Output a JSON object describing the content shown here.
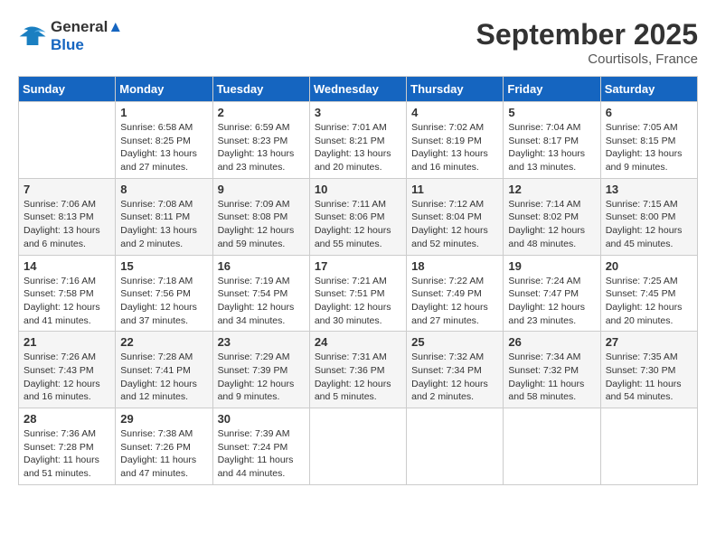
{
  "header": {
    "title": "September 2025",
    "location": "Courtisols, France",
    "logo_line1": "General",
    "logo_line2": "Blue"
  },
  "days_of_week": [
    "Sunday",
    "Monday",
    "Tuesday",
    "Wednesday",
    "Thursday",
    "Friday",
    "Saturday"
  ],
  "weeks": [
    [
      {
        "day": "",
        "sunrise": "",
        "sunset": "",
        "daylight": ""
      },
      {
        "day": "1",
        "sunrise": "Sunrise: 6:58 AM",
        "sunset": "Sunset: 8:25 PM",
        "daylight": "Daylight: 13 hours and 27 minutes."
      },
      {
        "day": "2",
        "sunrise": "Sunrise: 6:59 AM",
        "sunset": "Sunset: 8:23 PM",
        "daylight": "Daylight: 13 hours and 23 minutes."
      },
      {
        "day": "3",
        "sunrise": "Sunrise: 7:01 AM",
        "sunset": "Sunset: 8:21 PM",
        "daylight": "Daylight: 13 hours and 20 minutes."
      },
      {
        "day": "4",
        "sunrise": "Sunrise: 7:02 AM",
        "sunset": "Sunset: 8:19 PM",
        "daylight": "Daylight: 13 hours and 16 minutes."
      },
      {
        "day": "5",
        "sunrise": "Sunrise: 7:04 AM",
        "sunset": "Sunset: 8:17 PM",
        "daylight": "Daylight: 13 hours and 13 minutes."
      },
      {
        "day": "6",
        "sunrise": "Sunrise: 7:05 AM",
        "sunset": "Sunset: 8:15 PM",
        "daylight": "Daylight: 13 hours and 9 minutes."
      }
    ],
    [
      {
        "day": "7",
        "sunrise": "Sunrise: 7:06 AM",
        "sunset": "Sunset: 8:13 PM",
        "daylight": "Daylight: 13 hours and 6 minutes."
      },
      {
        "day": "8",
        "sunrise": "Sunrise: 7:08 AM",
        "sunset": "Sunset: 8:11 PM",
        "daylight": "Daylight: 13 hours and 2 minutes."
      },
      {
        "day": "9",
        "sunrise": "Sunrise: 7:09 AM",
        "sunset": "Sunset: 8:08 PM",
        "daylight": "Daylight: 12 hours and 59 minutes."
      },
      {
        "day": "10",
        "sunrise": "Sunrise: 7:11 AM",
        "sunset": "Sunset: 8:06 PM",
        "daylight": "Daylight: 12 hours and 55 minutes."
      },
      {
        "day": "11",
        "sunrise": "Sunrise: 7:12 AM",
        "sunset": "Sunset: 8:04 PM",
        "daylight": "Daylight: 12 hours and 52 minutes."
      },
      {
        "day": "12",
        "sunrise": "Sunrise: 7:14 AM",
        "sunset": "Sunset: 8:02 PM",
        "daylight": "Daylight: 12 hours and 48 minutes."
      },
      {
        "day": "13",
        "sunrise": "Sunrise: 7:15 AM",
        "sunset": "Sunset: 8:00 PM",
        "daylight": "Daylight: 12 hours and 45 minutes."
      }
    ],
    [
      {
        "day": "14",
        "sunrise": "Sunrise: 7:16 AM",
        "sunset": "Sunset: 7:58 PM",
        "daylight": "Daylight: 12 hours and 41 minutes."
      },
      {
        "day": "15",
        "sunrise": "Sunrise: 7:18 AM",
        "sunset": "Sunset: 7:56 PM",
        "daylight": "Daylight: 12 hours and 37 minutes."
      },
      {
        "day": "16",
        "sunrise": "Sunrise: 7:19 AM",
        "sunset": "Sunset: 7:54 PM",
        "daylight": "Daylight: 12 hours and 34 minutes."
      },
      {
        "day": "17",
        "sunrise": "Sunrise: 7:21 AM",
        "sunset": "Sunset: 7:51 PM",
        "daylight": "Daylight: 12 hours and 30 minutes."
      },
      {
        "day": "18",
        "sunrise": "Sunrise: 7:22 AM",
        "sunset": "Sunset: 7:49 PM",
        "daylight": "Daylight: 12 hours and 27 minutes."
      },
      {
        "day": "19",
        "sunrise": "Sunrise: 7:24 AM",
        "sunset": "Sunset: 7:47 PM",
        "daylight": "Daylight: 12 hours and 23 minutes."
      },
      {
        "day": "20",
        "sunrise": "Sunrise: 7:25 AM",
        "sunset": "Sunset: 7:45 PM",
        "daylight": "Daylight: 12 hours and 20 minutes."
      }
    ],
    [
      {
        "day": "21",
        "sunrise": "Sunrise: 7:26 AM",
        "sunset": "Sunset: 7:43 PM",
        "daylight": "Daylight: 12 hours and 16 minutes."
      },
      {
        "day": "22",
        "sunrise": "Sunrise: 7:28 AM",
        "sunset": "Sunset: 7:41 PM",
        "daylight": "Daylight: 12 hours and 12 minutes."
      },
      {
        "day": "23",
        "sunrise": "Sunrise: 7:29 AM",
        "sunset": "Sunset: 7:39 PM",
        "daylight": "Daylight: 12 hours and 9 minutes."
      },
      {
        "day": "24",
        "sunrise": "Sunrise: 7:31 AM",
        "sunset": "Sunset: 7:36 PM",
        "daylight": "Daylight: 12 hours and 5 minutes."
      },
      {
        "day": "25",
        "sunrise": "Sunrise: 7:32 AM",
        "sunset": "Sunset: 7:34 PM",
        "daylight": "Daylight: 12 hours and 2 minutes."
      },
      {
        "day": "26",
        "sunrise": "Sunrise: 7:34 AM",
        "sunset": "Sunset: 7:32 PM",
        "daylight": "Daylight: 11 hours and 58 minutes."
      },
      {
        "day": "27",
        "sunrise": "Sunrise: 7:35 AM",
        "sunset": "Sunset: 7:30 PM",
        "daylight": "Daylight: 11 hours and 54 minutes."
      }
    ],
    [
      {
        "day": "28",
        "sunrise": "Sunrise: 7:36 AM",
        "sunset": "Sunset: 7:28 PM",
        "daylight": "Daylight: 11 hours and 51 minutes."
      },
      {
        "day": "29",
        "sunrise": "Sunrise: 7:38 AM",
        "sunset": "Sunset: 7:26 PM",
        "daylight": "Daylight: 11 hours and 47 minutes."
      },
      {
        "day": "30",
        "sunrise": "Sunrise: 7:39 AM",
        "sunset": "Sunset: 7:24 PM",
        "daylight": "Daylight: 11 hours and 44 minutes."
      },
      {
        "day": "",
        "sunrise": "",
        "sunset": "",
        "daylight": ""
      },
      {
        "day": "",
        "sunrise": "",
        "sunset": "",
        "daylight": ""
      },
      {
        "day": "",
        "sunrise": "",
        "sunset": "",
        "daylight": ""
      },
      {
        "day": "",
        "sunrise": "",
        "sunset": "",
        "daylight": ""
      }
    ]
  ]
}
